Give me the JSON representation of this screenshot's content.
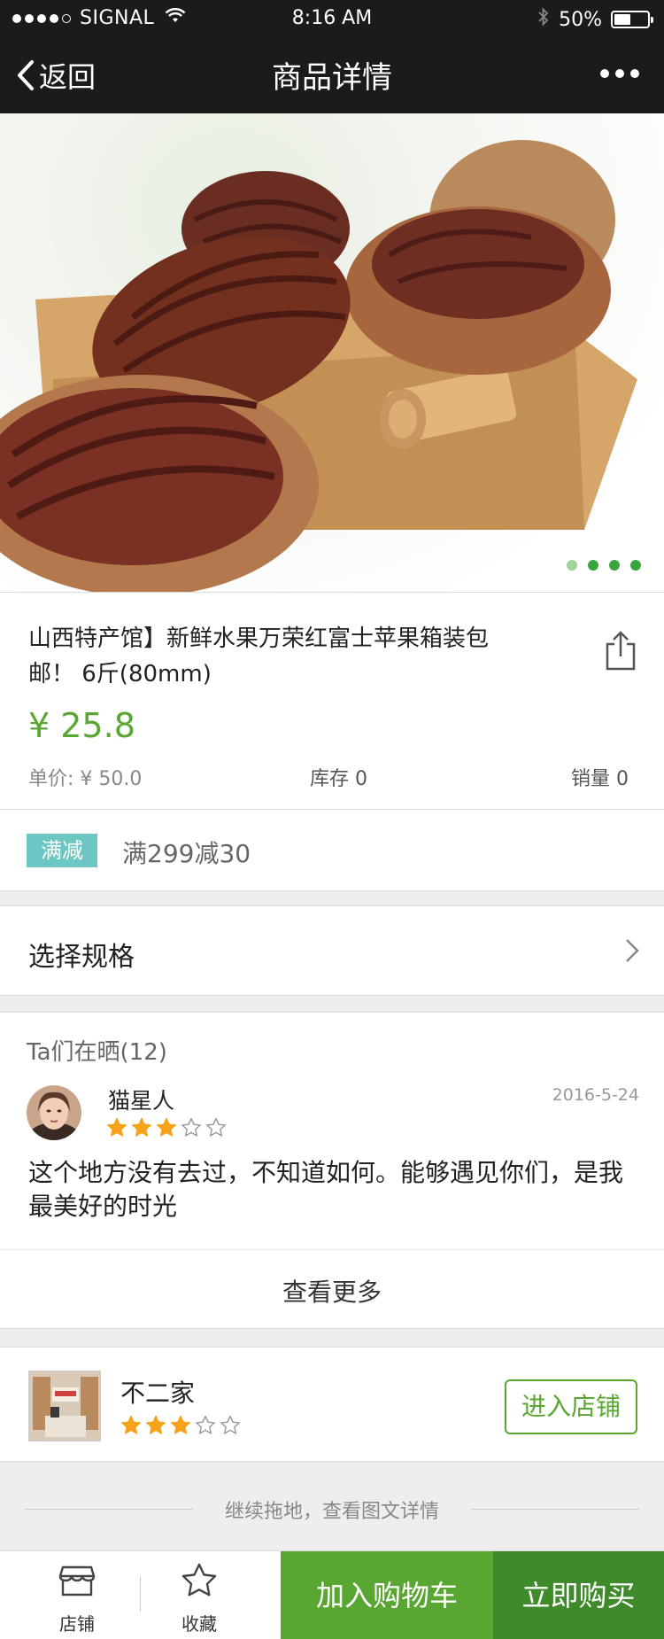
{
  "status_bar": {
    "carrier": "SIGNAL",
    "time": "8:16 AM",
    "battery": "50%",
    "battery_level": 0.5
  },
  "nav": {
    "back_label": "返回",
    "title": "商品详情",
    "more_icon": "more-icon"
  },
  "gallery": {
    "page_count": 4,
    "active_index": 0
  },
  "product": {
    "name": "山西特产馆】新鲜水果万荣红富士苹果箱装包邮！ 6斤(80mm)",
    "price": "¥ 25.8",
    "unit_price": "单价: ¥ 50.0",
    "stock": "库存 0",
    "sales": "销量 0",
    "accent_color": "#5aa632"
  },
  "promo": {
    "badge": "满减",
    "text": "满299减30"
  },
  "spec": {
    "label": "选择规格"
  },
  "reviews": {
    "header": "Ta们在晒(12)",
    "items": [
      {
        "user": "猫星人",
        "date": "2016-5-24",
        "rating": 3,
        "max_rating": 5,
        "content": "这个地方没有去过，不知道如何。能够遇见你们，是我最美好的时光"
      }
    ],
    "more_label": "查看更多"
  },
  "shop": {
    "name": "不二家",
    "rating": 3,
    "max_rating": 5,
    "enter_label": "进入店铺"
  },
  "hint": {
    "text": "继续拖地，查看图文详情"
  },
  "bottom_bar": {
    "shop_label": "店铺",
    "favorite_label": "收藏",
    "add_cart_label": "加入购物车",
    "buy_now_label": "立即购买"
  }
}
